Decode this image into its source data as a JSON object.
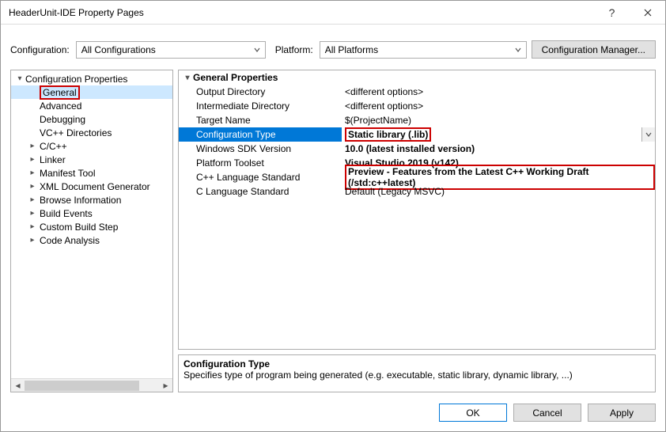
{
  "title": "HeaderUnit-IDE Property Pages",
  "config": {
    "config_label": "Configuration:",
    "config_value": "All Configurations",
    "platform_label": "Platform:",
    "platform_value": "All Platforms",
    "manager_label": "Configuration Manager..."
  },
  "tree": [
    {
      "label": "Configuration Properties",
      "depth": 0,
      "exp": "▾"
    },
    {
      "label": "General",
      "depth": 1,
      "exp": "",
      "selected": true,
      "highlight": true
    },
    {
      "label": "Advanced",
      "depth": 1,
      "exp": ""
    },
    {
      "label": "Debugging",
      "depth": 1,
      "exp": ""
    },
    {
      "label": "VC++ Directories",
      "depth": 1,
      "exp": ""
    },
    {
      "label": "C/C++",
      "depth": 1,
      "exp": "▸"
    },
    {
      "label": "Linker",
      "depth": 1,
      "exp": "▸"
    },
    {
      "label": "Manifest Tool",
      "depth": 1,
      "exp": "▸"
    },
    {
      "label": "XML Document Generator",
      "depth": 1,
      "exp": "▸"
    },
    {
      "label": "Browse Information",
      "depth": 1,
      "exp": "▸"
    },
    {
      "label": "Build Events",
      "depth": 1,
      "exp": "▸"
    },
    {
      "label": "Custom Build Step",
      "depth": 1,
      "exp": "▸"
    },
    {
      "label": "Code Analysis",
      "depth": 1,
      "exp": "▸"
    }
  ],
  "grid": {
    "header": "General Properties",
    "rows": [
      {
        "label": "Output Directory",
        "value": "<different options>"
      },
      {
        "label": "Intermediate Directory",
        "value": "<different options>"
      },
      {
        "label": "Target Name",
        "value": "$(ProjectName)"
      },
      {
        "label": "Configuration Type",
        "value": "Static library (.lib)",
        "selected": true,
        "highlight": true
      },
      {
        "label": "Windows SDK Version",
        "value": "10.0 (latest installed version)",
        "bold": true
      },
      {
        "label": "Platform Toolset",
        "value": "Visual Studio 2019 (v142)",
        "bold": true
      },
      {
        "label": "C++ Language Standard",
        "value": "Preview - Features from the Latest C++ Working Draft (/std:c++latest)",
        "bold": true,
        "highlight": true
      },
      {
        "label": "C Language Standard",
        "value": "Default (Legacy MSVC)"
      }
    ]
  },
  "desc": {
    "title": "Configuration Type",
    "body": "Specifies type of program being generated (e.g. executable, static library, dynamic library, ...)"
  },
  "buttons": {
    "ok": "OK",
    "cancel": "Cancel",
    "apply": "Apply"
  }
}
